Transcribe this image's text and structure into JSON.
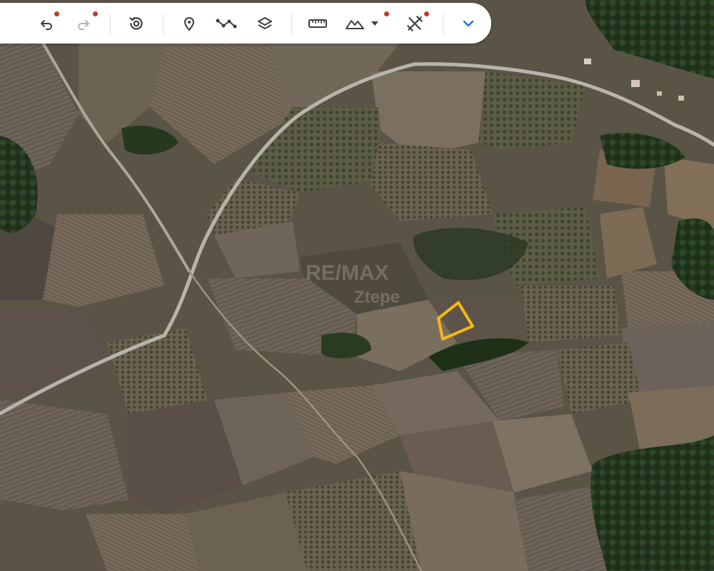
{
  "toolbar": {
    "buttons": [
      {
        "name": "undo-button",
        "icon": "undo-icon",
        "active": true,
        "badge": true
      },
      {
        "name": "redo-button",
        "icon": "redo-icon",
        "active": false,
        "badge": true
      },
      {
        "name": "history-button",
        "icon": "history-icon",
        "active": true,
        "badge": false
      },
      {
        "name": "add-placemark-button",
        "icon": "location-pin-icon",
        "active": true,
        "badge": false
      },
      {
        "name": "add-path-button",
        "icon": "path-icon",
        "active": true,
        "badge": false
      },
      {
        "name": "layers-button",
        "icon": "layers-icon",
        "active": true,
        "badge": false
      },
      {
        "name": "measure-button",
        "icon": "ruler-icon",
        "active": true,
        "badge": false
      },
      {
        "name": "elevation-button",
        "icon": "terrain-icon",
        "active": true,
        "badge": true
      },
      {
        "name": "tools-button",
        "icon": "tools-icon",
        "active": true,
        "badge": true
      },
      {
        "name": "expand-button",
        "icon": "chevron-down-icon",
        "active": true,
        "badge": false
      }
    ],
    "badge_color": "#c0392b",
    "accent_color": "#1a73e8"
  },
  "map": {
    "type": "satellite",
    "watermark": {
      "line1": "RE/MAX",
      "line2": "Ztepe"
    },
    "highlight": {
      "shape": "parcel-outline",
      "color": "#f5b819"
    }
  }
}
